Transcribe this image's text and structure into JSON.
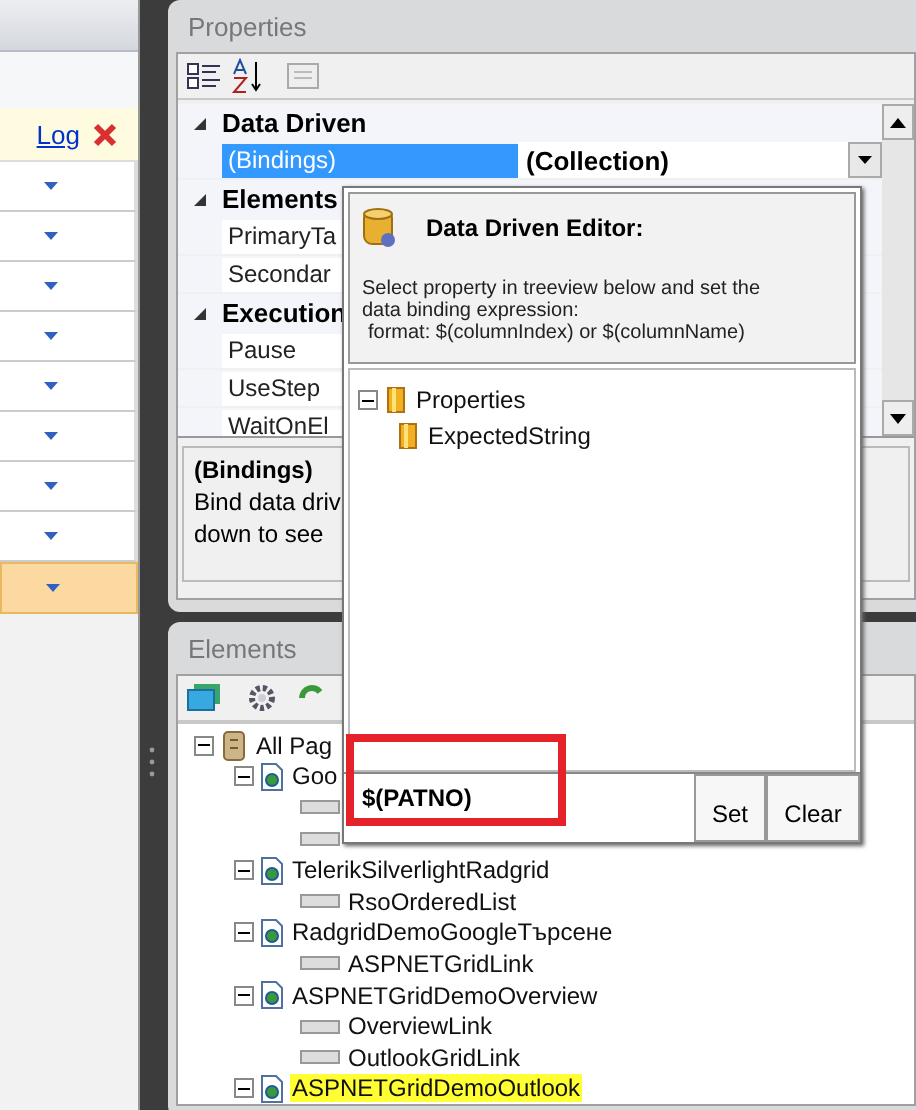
{
  "left_panel": {
    "log_link": "Log",
    "rows": [
      {
        "selected": false
      },
      {
        "selected": false
      },
      {
        "selected": false
      },
      {
        "selected": false
      },
      {
        "selected": false
      },
      {
        "selected": false
      },
      {
        "selected": false
      },
      {
        "selected": false
      },
      {
        "selected": true
      }
    ]
  },
  "properties": {
    "title": "Properties",
    "categories": [
      {
        "name": "Data Driven",
        "expanded": true,
        "items": [
          {
            "name": "(Bindings)",
            "value": "(Collection)",
            "selected": true
          }
        ]
      },
      {
        "name": "Elements",
        "expanded": true,
        "items": [
          {
            "name": "PrimaryTa",
            "selected": false
          },
          {
            "name": "Secondar",
            "selected": false
          }
        ]
      },
      {
        "name": "Execution",
        "expanded": true,
        "items": [
          {
            "name": "Pause",
            "selected": false
          },
          {
            "name": "UseStep",
            "selected": false
          },
          {
            "name": "WaitOnEl",
            "selected": false
          }
        ]
      }
    ],
    "description": {
      "title": "(Bindings)",
      "lines": [
        "Bind data driv",
        "down to see"
      ]
    }
  },
  "data_driven_editor": {
    "title": "Data Driven Editor:",
    "instructions": "Select property in treeview below and set the data binding expression:",
    "format": "format:  $(columnIndex) or $(columnName)",
    "tree": [
      {
        "label": "Properties",
        "expanded": true,
        "children": [
          {
            "label": "ExpectedString"
          }
        ]
      }
    ],
    "expression": "$(PATNO)",
    "buttons": [
      "Set",
      "Clear"
    ]
  },
  "elements": {
    "title": "Elements",
    "tree": [
      {
        "kind": "root",
        "label": "All Pag",
        "expanded": true,
        "selected": false,
        "children": [
          {
            "kind": "page",
            "label": "Goo",
            "expanded": true,
            "selected": false,
            "children": [
              {
                "kind": "element"
              },
              {
                "kind": "element"
              }
            ]
          },
          {
            "kind": "page",
            "label": "TelerikSilverlightRadgrid",
            "expanded": true,
            "selected": false,
            "children": [
              {
                "kind": "element",
                "label": "RsoOrderedList",
                "selected": false
              }
            ]
          },
          {
            "kind": "page",
            "label": "RadgridDemoGoogleТърсене",
            "expanded": true,
            "selected": false,
            "children": [
              {
                "kind": "element",
                "label": "ASPNETGridLink",
                "selected": false
              }
            ]
          },
          {
            "kind": "page",
            "label": "ASPNETGridDemoOverview",
            "expanded": true,
            "selected": false,
            "children": [
              {
                "kind": "element",
                "label": "OverviewLink",
                "selected": false
              },
              {
                "kind": "element",
                "label": "OutlookGridLink",
                "selected": false
              }
            ]
          },
          {
            "kind": "page",
            "label": "ASPNETGridDemoOutlook",
            "expanded": true,
            "selected": true
          }
        ]
      }
    ]
  }
}
